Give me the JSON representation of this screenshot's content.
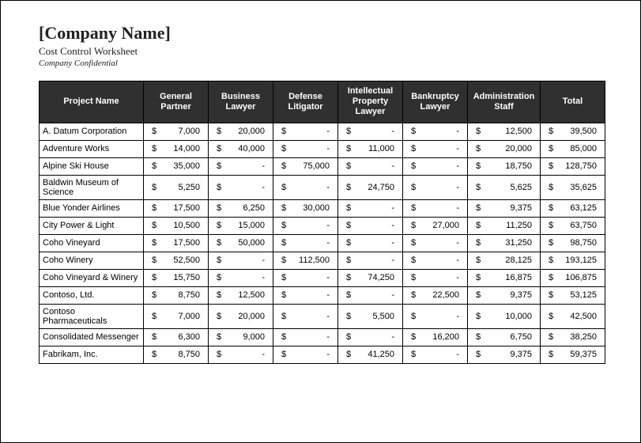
{
  "header": {
    "company_name": "[Company Name]",
    "subtitle": "Cost Control Worksheet",
    "confidential": "Company Confidential"
  },
  "columns": [
    "Project Name",
    "General Partner",
    "Business Lawyer",
    "Defense Litigator",
    "Intellectual Property Lawyer",
    "Bankruptcy Lawyer",
    "Administration Staff",
    "Total"
  ],
  "currency_symbol": "$",
  "rows": [
    {
      "name": "A. Datum Corporation",
      "values": [
        "7,000",
        "20,000",
        "-",
        "-",
        "-",
        "12,500",
        "39,500"
      ]
    },
    {
      "name": "Adventure Works",
      "values": [
        "14,000",
        "40,000",
        "-",
        "11,000",
        "-",
        "20,000",
        "85,000"
      ]
    },
    {
      "name": "Alpine Ski House",
      "values": [
        "35,000",
        "-",
        "75,000",
        "-",
        "-",
        "18,750",
        "128,750"
      ]
    },
    {
      "name": "Baldwin Museum of Science",
      "values": [
        "5,250",
        "-",
        "-",
        "24,750",
        "-",
        "5,625",
        "35,625"
      ]
    },
    {
      "name": "Blue Yonder Airlines",
      "values": [
        "17,500",
        "6,250",
        "30,000",
        "-",
        "-",
        "9,375",
        "63,125"
      ]
    },
    {
      "name": "City Power & Light",
      "values": [
        "10,500",
        "15,000",
        "-",
        "-",
        "27,000",
        "11,250",
        "63,750"
      ]
    },
    {
      "name": "Coho Vineyard",
      "values": [
        "17,500",
        "50,000",
        "-",
        "-",
        "-",
        "31,250",
        "98,750"
      ]
    },
    {
      "name": "Coho Winery",
      "values": [
        "52,500",
        "-",
        "112,500",
        "-",
        "-",
        "28,125",
        "193,125"
      ]
    },
    {
      "name": "Coho Vineyard & Winery",
      "values": [
        "15,750",
        "-",
        "-",
        "74,250",
        "-",
        "16,875",
        "106,875"
      ]
    },
    {
      "name": "Contoso, Ltd.",
      "values": [
        "8,750",
        "12,500",
        "-",
        "-",
        "22,500",
        "9,375",
        "53,125"
      ]
    },
    {
      "name": "Contoso Pharmaceuticals",
      "values": [
        "7,000",
        "20,000",
        "-",
        "5,500",
        "-",
        "10,000",
        "42,500"
      ]
    },
    {
      "name": "Consolidated Messenger",
      "values": [
        "6,300",
        "9,000",
        "-",
        "-",
        "16,200",
        "6,750",
        "38,250"
      ]
    },
    {
      "name": "Fabrikam, Inc.",
      "values": [
        "8,750",
        "-",
        "-",
        "41,250",
        "-",
        "9,375",
        "59,375"
      ]
    }
  ],
  "chart_data": {
    "type": "table",
    "title": "Cost Control Worksheet",
    "columns": [
      "Project Name",
      "General Partner",
      "Business Lawyer",
      "Defense Litigator",
      "Intellectual Property Lawyer",
      "Bankruptcy Lawyer",
      "Administration Staff",
      "Total"
    ],
    "rows": [
      [
        "A. Datum Corporation",
        7000,
        20000,
        null,
        null,
        null,
        12500,
        39500
      ],
      [
        "Adventure Works",
        14000,
        40000,
        null,
        11000,
        null,
        20000,
        85000
      ],
      [
        "Alpine Ski House",
        35000,
        null,
        75000,
        null,
        null,
        18750,
        128750
      ],
      [
        "Baldwin Museum of Science",
        5250,
        null,
        null,
        24750,
        null,
        5625,
        35625
      ],
      [
        "Blue Yonder Airlines",
        17500,
        6250,
        30000,
        null,
        null,
        9375,
        63125
      ],
      [
        "City Power & Light",
        10500,
        15000,
        null,
        null,
        27000,
        11250,
        63750
      ],
      [
        "Coho Vineyard",
        17500,
        50000,
        null,
        null,
        null,
        31250,
        98750
      ],
      [
        "Coho Winery",
        52500,
        null,
        112500,
        null,
        null,
        28125,
        193125
      ],
      [
        "Coho Vineyard & Winery",
        15750,
        null,
        null,
        74250,
        null,
        16875,
        106875
      ],
      [
        "Contoso, Ltd.",
        8750,
        12500,
        null,
        null,
        22500,
        9375,
        53125
      ],
      [
        "Contoso Pharmaceuticals",
        7000,
        20000,
        null,
        5500,
        null,
        10000,
        42500
      ],
      [
        "Consolidated Messenger",
        6300,
        9000,
        null,
        null,
        16200,
        6750,
        38250
      ],
      [
        "Fabrikam, Inc.",
        8750,
        null,
        null,
        41250,
        null,
        9375,
        59375
      ]
    ]
  }
}
